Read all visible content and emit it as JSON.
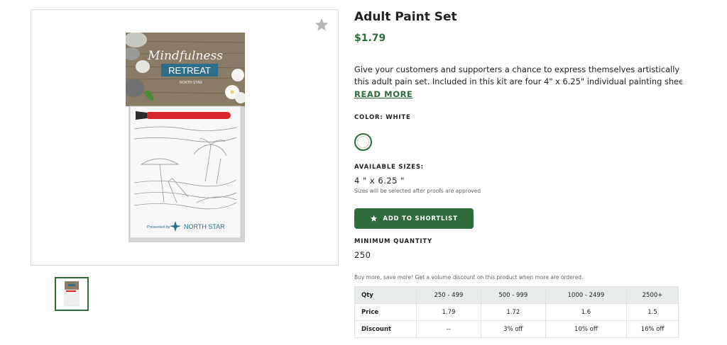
{
  "product": {
    "title": "Adult Paint Set",
    "price": "$1.79",
    "description_line1": "Give your customers and supporters a chance to express themselves artistically with",
    "description_line2": "this adult pain set. Included in this kit are four 4\" x 6.25\" individual painting sheets, ...",
    "read_more": "READ MORE"
  },
  "image": {
    "card_script": "Mindfulness",
    "card_title": "RETREAT",
    "card_presented": "Presented by",
    "card_brand": "NORTH STAR",
    "favorite_icon": "star-icon"
  },
  "color": {
    "label": "COLOR: WHITE",
    "swatch": "#ffffff"
  },
  "sizes": {
    "label": "AVAILABLE SIZES:",
    "value": "4 \" x 6.25 \"",
    "note": "Sizes will be selected after proofs are approved"
  },
  "shortlist": {
    "label": "ADD TO SHORTLIST",
    "icon": "star-icon"
  },
  "min_quantity": {
    "label": "MINIMUM QUANTITY",
    "value": "250"
  },
  "volume_note": "Buy more, save more! Get a volume discount on this product when more are ordered.",
  "pricing_table": {
    "headers": [
      "Qty",
      "250 - 499",
      "500 - 999",
      "1000 - 2499",
      "2500+"
    ],
    "price_row": [
      "Price",
      "1.79",
      "1.72",
      "1.6",
      "1.5"
    ],
    "discount_row": [
      "Discount",
      "--",
      "3% off",
      "10% off",
      "16% off"
    ]
  },
  "colors": {
    "accent": "#2e6b3d",
    "table_header": "#e8ece8"
  }
}
